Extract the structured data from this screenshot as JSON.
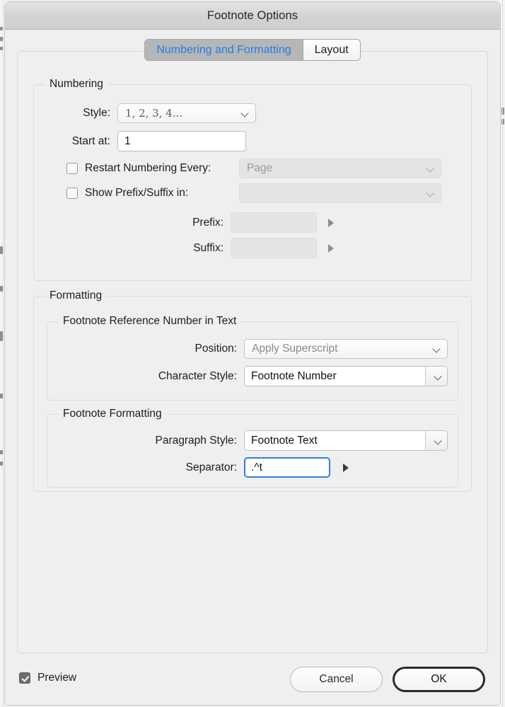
{
  "window": {
    "title": "Footnote Options"
  },
  "tabs": [
    {
      "label": "Numbering and Formatting",
      "active": true
    },
    {
      "label": "Layout",
      "active": false
    }
  ],
  "numbering": {
    "legend": "Numbering",
    "style": {
      "label": "Style:",
      "value": "1, 2, 3, 4...",
      "icon": "chevron-down-icon"
    },
    "start_at": {
      "label": "Start at:",
      "value": "1"
    },
    "restart": {
      "label": "Restart Numbering Every:",
      "checked": false,
      "value": "Page",
      "enabled": false
    },
    "prefix_suffix": {
      "label": "Show Prefix/Suffix in:",
      "checked": false,
      "value": "",
      "enabled": false
    },
    "prefix": {
      "label": "Prefix:",
      "value": "",
      "enabled": false,
      "icon": "triangle-right-icon"
    },
    "suffix": {
      "label": "Suffix:",
      "value": "",
      "enabled": false,
      "icon": "triangle-right-icon"
    }
  },
  "formatting": {
    "legend": "Formatting",
    "reference_number": {
      "legend": "Footnote Reference Number in Text",
      "position": {
        "label": "Position:",
        "value": "Apply Superscript",
        "icon": "chevron-down-icon"
      },
      "character_style": {
        "label": "Character Style:",
        "value": "Footnote Number",
        "icon": "chevron-down-icon"
      }
    },
    "footnote_formatting": {
      "legend": "Footnote Formatting",
      "paragraph_style": {
        "label": "Paragraph Style:",
        "value": "Footnote Text",
        "icon": "chevron-down-icon"
      },
      "separator": {
        "label": "Separator:",
        "value": ".^t",
        "focused": true,
        "icon": "triangle-right-icon"
      }
    }
  },
  "footer": {
    "preview": {
      "label": "Preview",
      "checked": true
    },
    "cancel": {
      "label": "Cancel"
    },
    "ok": {
      "label": "OK",
      "default": true
    }
  },
  "colors": {
    "accent_blue": "#1f7fe8",
    "focus_blue": "#2f7fe0",
    "window_bg": "#efefef",
    "titlebar_bg": "#d3d3d3",
    "disabled_text": "#9b9b9b"
  }
}
